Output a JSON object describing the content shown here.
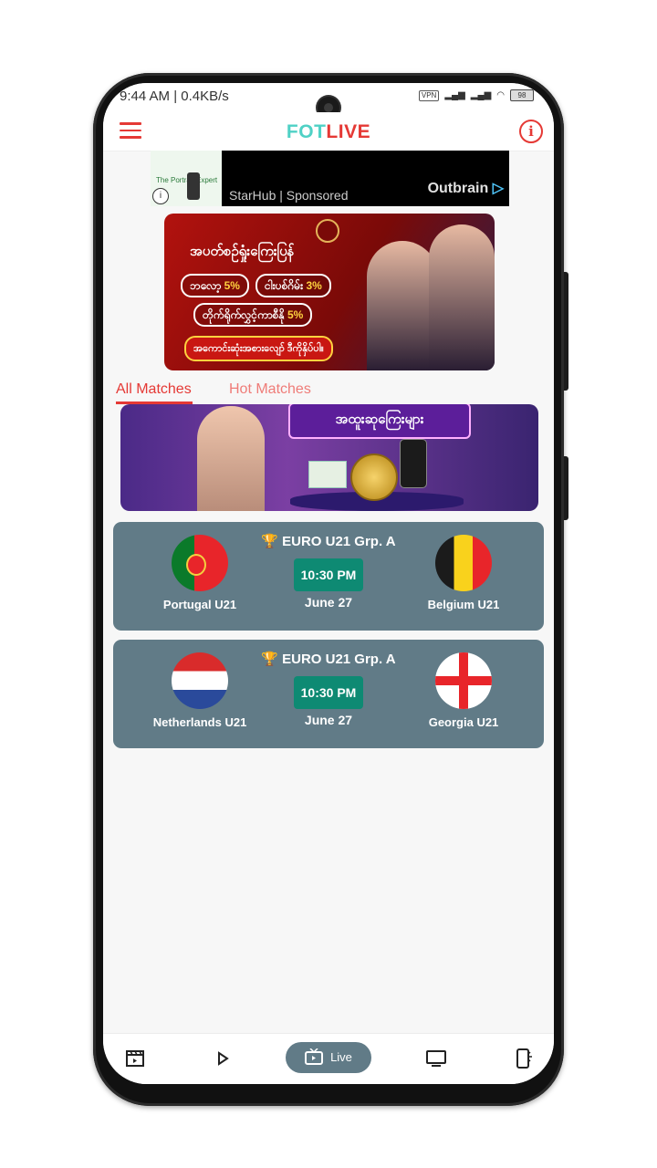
{
  "status_bar": {
    "time": "9:44 AM | 0.4KB/s",
    "vpn": "VPN",
    "battery": "98"
  },
  "app": {
    "logo_part1": "FOT",
    "logo_part2": "LIVE",
    "info_symbol": "i"
  },
  "ad": {
    "thumb_text": "The Portrait Expert",
    "info_symbol": "i",
    "sponsor_text": "StarHub | Sponsored",
    "brand": "Outbrain",
    "brand_mark": "▷"
  },
  "banner1": {
    "headline": "အပတ်စဉ်ရှုံးကြေးပြန်",
    "pill1_text": "ဘလော့",
    "pill1_value": "5%",
    "pill2_text": "ငါးပစ်ဂိမ်း",
    "pill2_value": "3%",
    "pill3_text": "တိုက်ရိုက်လွှင့်ကာစီနို",
    "pill3_value": "5%",
    "footer": "အကောင်းဆုံးအစားလျော် ဒီကိုနှိပ်ပါ။"
  },
  "tabs": [
    {
      "label": "All Matches",
      "active": true
    },
    {
      "label": "Hot Matches",
      "active": false
    }
  ],
  "banner2": {
    "headline": "အထူးဆုကြေးများ"
  },
  "matches": [
    {
      "league": "EURO U21 Grp. A",
      "time": "10:30 PM",
      "date": "June 27",
      "home": "Portugal U21",
      "away": "Belgium U21"
    },
    {
      "league": "EURO U21 Grp. A",
      "time": "10:30 PM",
      "date": "June 27",
      "home": "Netherlands U21",
      "away": "Georgia U21"
    }
  ],
  "bottom_nav": {
    "live_label": "Live"
  },
  "colors": {
    "accent": "#e53935",
    "match_card": "#617b87",
    "time_badge": "#0e8a73",
    "logo_teal": "#4fd1c5"
  },
  "icons": {
    "menu": "menu-icon",
    "info": "info-icon",
    "trophy": "trophy-icon",
    "nav_highlights": "clapperboard-icon",
    "nav_play": "play-icon",
    "nav_live": "live-tv-icon",
    "nav_tv": "monitor-icon",
    "nav_more": "phone-sparkle-icon"
  }
}
